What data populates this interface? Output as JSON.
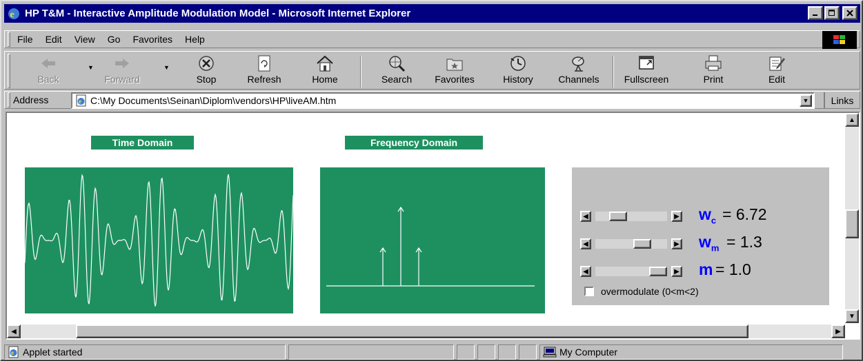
{
  "window": {
    "title": "HP T&M - Interactive Amplitude Modulation Model - Microsoft Internet Explorer",
    "controls": [
      "minimize",
      "maximize",
      "close"
    ]
  },
  "menu": [
    "File",
    "Edit",
    "View",
    "Go",
    "Favorites",
    "Help"
  ],
  "toolbar": {
    "back": "Back",
    "forward": "Forward",
    "stop": "Stop",
    "refresh": "Refresh",
    "home": "Home",
    "search": "Search",
    "favorites": "Favorites",
    "history": "History",
    "channels": "Channels",
    "fullscreen": "Fullscreen",
    "print": "Print",
    "edit": "Edit"
  },
  "address": {
    "label": "Address",
    "value": "C:\\My Documents\\Seinan\\Diplom\\vendors\\HP\\liveAM.htm",
    "links": "Links"
  },
  "applet": {
    "time_header": "Time Domain",
    "freq_header": "Frequency Domain",
    "colors": {
      "plot_bg": "#1e9060",
      "trace": "#ffffff",
      "param": "#0000ff"
    },
    "params": [
      {
        "symbol": "w",
        "sub": "c",
        "equals": "= 6.72",
        "level": 0.25
      },
      {
        "symbol": "w",
        "sub": "m",
        "equals": "= 1.3",
        "level": 0.7
      },
      {
        "symbol": "m",
        "sub": "",
        "equals": "= 1.0",
        "level": 1.0
      }
    ],
    "overmodulate_label": "overmodulate (0<m<2)",
    "overmodulate_checked": false
  },
  "status": {
    "text": "Applet started",
    "zone": "My Computer"
  }
}
